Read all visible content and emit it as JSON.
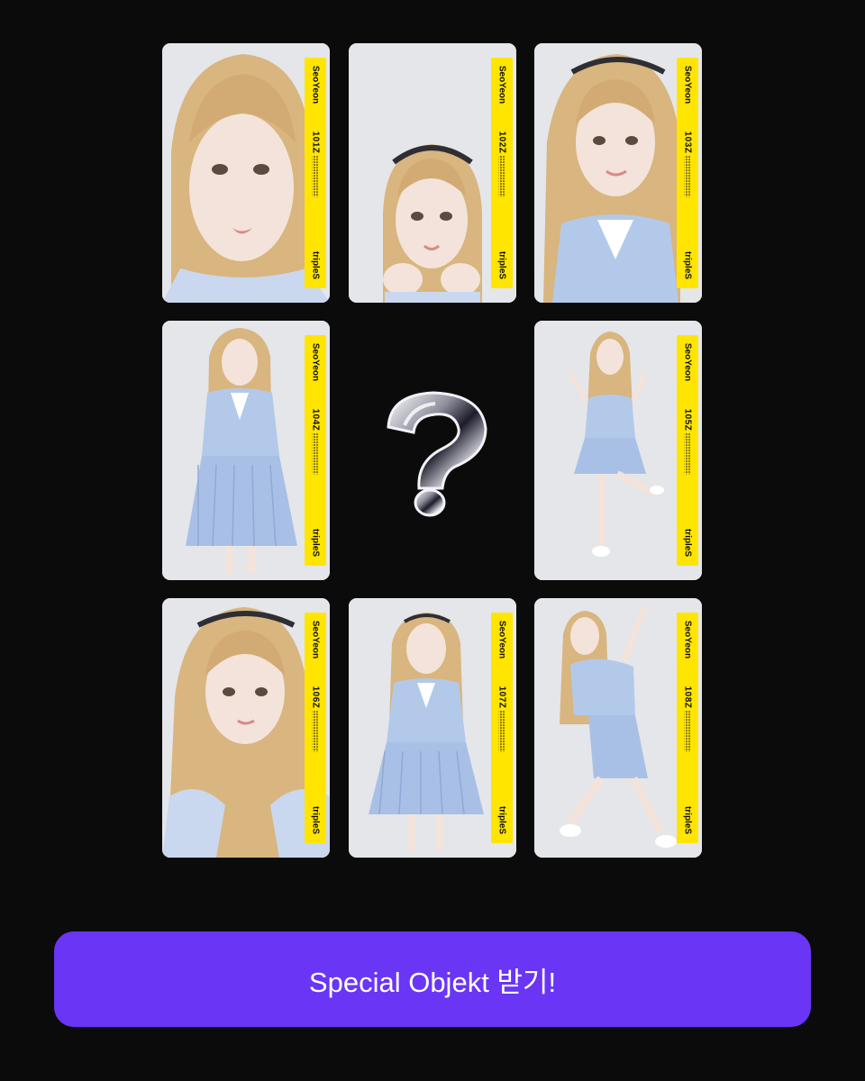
{
  "cards": [
    {
      "member": "SeoYeon",
      "serial": "101Z",
      "group": "tripleS",
      "shot": "close-up"
    },
    {
      "member": "SeoYeon",
      "serial": "102Z",
      "group": "tripleS",
      "shot": "hands-up"
    },
    {
      "member": "SeoYeon",
      "serial": "103Z",
      "group": "tripleS",
      "shot": "half-body"
    },
    {
      "member": "SeoYeon",
      "serial": "104Z",
      "group": "tripleS",
      "shot": "full-body"
    },
    {
      "member": "SeoYeon",
      "serial": "105Z",
      "group": "tripleS",
      "shot": "full-body-pose"
    },
    {
      "member": "SeoYeon",
      "serial": "106Z",
      "group": "tripleS",
      "shot": "half-body"
    },
    {
      "member": "SeoYeon",
      "serial": "107Z",
      "group": "tripleS",
      "shot": "full-body"
    },
    {
      "member": "SeoYeon",
      "serial": "108Z",
      "group": "tripleS",
      "shot": "full-body-pose"
    }
  ],
  "mystery_icon": "question-mark-icon",
  "cta": {
    "label": "Special Objekt 받기!"
  },
  "colors": {
    "background": "#0b0b0b",
    "button": "#6a35f5",
    "stripe": "#ffe500",
    "photo_bg": "#e4e6ea",
    "hair": "#d9b57f",
    "outfit": "#b3c9ea"
  }
}
